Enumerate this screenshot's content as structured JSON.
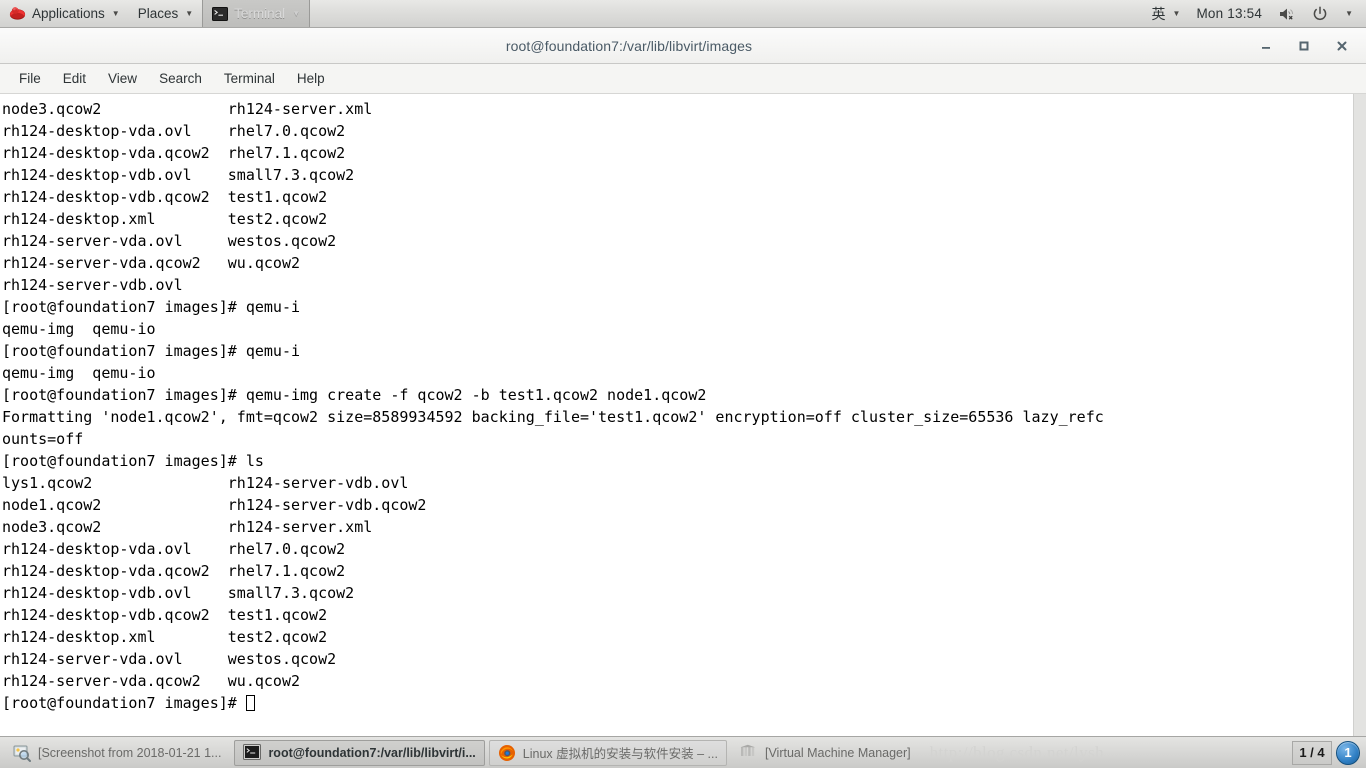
{
  "top_panel": {
    "applications_label": "Applications",
    "places_label": "Places",
    "terminal_label": "Terminal",
    "input_method_label": "英",
    "clock": "Mon 13:54",
    "caret": "▼",
    "icons": {
      "redhat": "redhat-logo-icon",
      "terminal": "terminal-icon",
      "volume_muted": "volume-muted-icon",
      "power": "power-icon"
    }
  },
  "window": {
    "title": "root@foundation7:/var/lib/libvirt/images",
    "buttons": {
      "minimize": "−",
      "maximize": "□",
      "close": "✕"
    }
  },
  "menubar": {
    "items": [
      {
        "label": "File"
      },
      {
        "label": "Edit"
      },
      {
        "label": "View"
      },
      {
        "label": "Search"
      },
      {
        "label": "Terminal"
      },
      {
        "label": "Help"
      }
    ]
  },
  "terminal": {
    "prompt": "[root@foundation7 images]# ",
    "content": "node3.qcow2              rh124-server.xml\nrh124-desktop-vda.ovl    rhel7.0.qcow2\nrh124-desktop-vda.qcow2  rhel7.1.qcow2\nrh124-desktop-vdb.ovl    small7.3.qcow2\nrh124-desktop-vdb.qcow2  test1.qcow2\nrh124-desktop.xml        test2.qcow2\nrh124-server-vda.ovl     westos.qcow2\nrh124-server-vda.qcow2   wu.qcow2\nrh124-server-vdb.ovl\n[root@foundation7 images]# qemu-i\nqemu-img  qemu-io\n[root@foundation7 images]# qemu-i\nqemu-img  qemu-io\n[root@foundation7 images]# qemu-img create -f qcow2 -b test1.qcow2 node1.qcow2\nFormatting 'node1.qcow2', fmt=qcow2 size=8589934592 backing_file='test1.qcow2' encryption=off cluster_size=65536 lazy_refc\nounts=off\n[root@foundation7 images]# ls\nlys1.qcow2               rh124-server-vdb.ovl\nnode1.qcow2              rh124-server-vdb.qcow2\nnode3.qcow2              rh124-server.xml\nrh124-desktop-vda.ovl    rhel7.0.qcow2\nrh124-desktop-vda.qcow2  rhel7.1.qcow2\nrh124-desktop-vdb.ovl    small7.3.qcow2\nrh124-desktop-vdb.qcow2  test1.qcow2\nrh124-desktop.xml        test2.qcow2\nrh124-server-vda.ovl     westos.qcow2\nrh124-server-vda.qcow2   wu.qcow2\n",
    "last_prompt": "[root@foundation7 images]# "
  },
  "taskbar": {
    "tasks": [
      {
        "label": "[Screenshot from 2018-01-21 1...",
        "icon": "screenshot-icon",
        "state": "minimized"
      },
      {
        "label": "root@foundation7:/var/lib/libvirt/i...",
        "icon": "terminal-icon",
        "state": "active"
      },
      {
        "label": "Linux 虚拟机的安装与软件安装 – ...",
        "icon": "firefox-icon",
        "state": "inactive"
      },
      {
        "label": "[Virtual Machine Manager]",
        "icon": "vmm-icon",
        "state": "minimized"
      }
    ],
    "watermark": "http://blog.csdn.net/lysh",
    "workspace": "1 / 4",
    "notification_count": "1"
  }
}
